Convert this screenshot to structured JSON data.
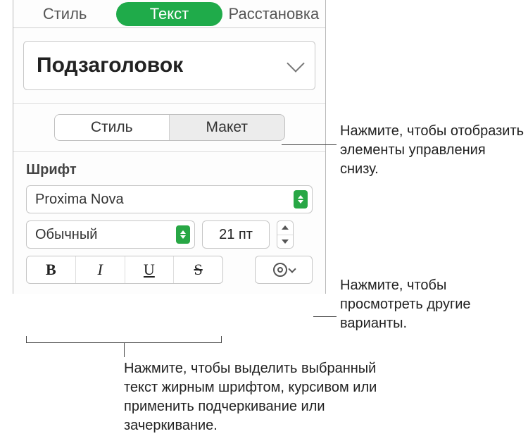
{
  "tabs": {
    "style": "Стиль",
    "text": "Текст",
    "arrange": "Расстановка"
  },
  "paragraph_style": "Подзаголовок",
  "segmented": {
    "style": "Стиль",
    "layout": "Макет"
  },
  "font_section_label": "Шрифт",
  "font_family": "Proxima Nova",
  "font_face": "Обычный",
  "font_size": "21 пт",
  "bius": {
    "bold": "B",
    "italic": "I",
    "underline": "U",
    "strike": "S"
  },
  "callouts": {
    "segmented": "Нажмите, чтобы отобразить элементы управления снизу.",
    "more": "Нажмите, чтобы просмотреть другие варианты.",
    "bius": "Нажмите, чтобы выделить выбранный текст жирным шрифтом, курсивом или применить подчеркивание или зачеркивание."
  }
}
